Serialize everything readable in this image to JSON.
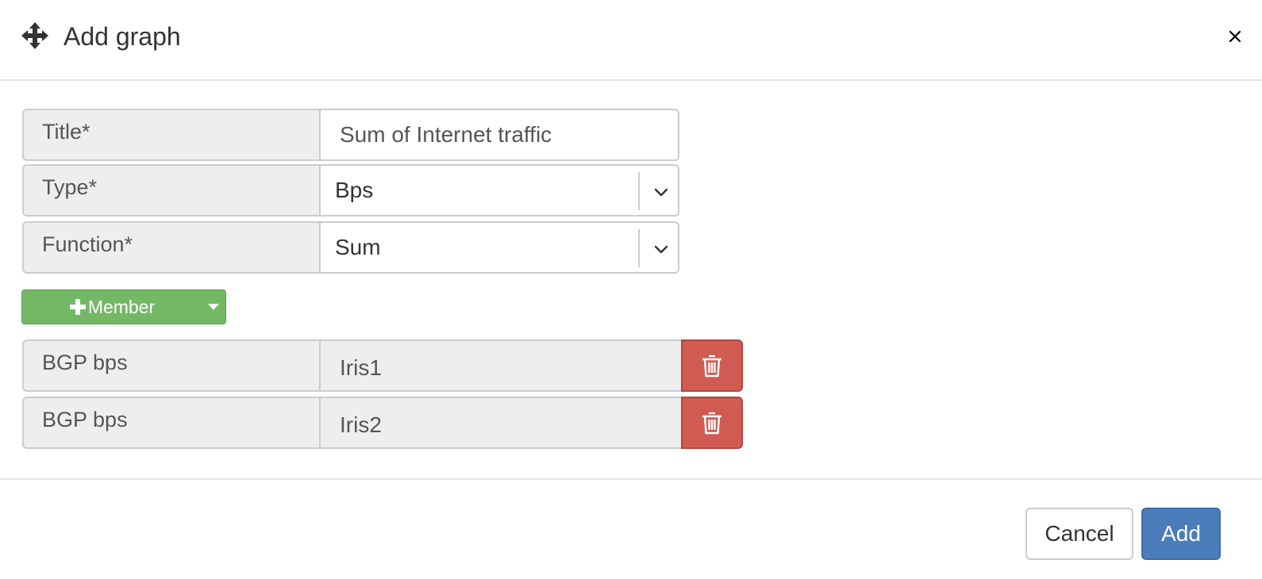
{
  "dialog": {
    "title": "Add graph",
    "close_label": "×"
  },
  "form": {
    "title": {
      "label": "Title*",
      "value": "Sum of Internet traffic"
    },
    "type": {
      "label": "Type*",
      "value": "Bps"
    },
    "function": {
      "label": "Function*",
      "value": "Sum"
    }
  },
  "member_button": {
    "label": "Member"
  },
  "members": [
    {
      "label": "BGP bps",
      "value": "Iris1"
    },
    {
      "label": "BGP bps",
      "value": "Iris2"
    }
  ],
  "footer": {
    "cancel_label": "Cancel",
    "add_label": "Add"
  },
  "colors": {
    "success": "#74b865",
    "danger": "#cf5b52",
    "primary": "#4a7db9"
  },
  "icons": {
    "move": "move-icon",
    "close": "close-icon",
    "chevron": "chevron-down-icon",
    "caret": "caret-down-icon",
    "plus": "plus-icon",
    "trash": "trash-icon"
  }
}
